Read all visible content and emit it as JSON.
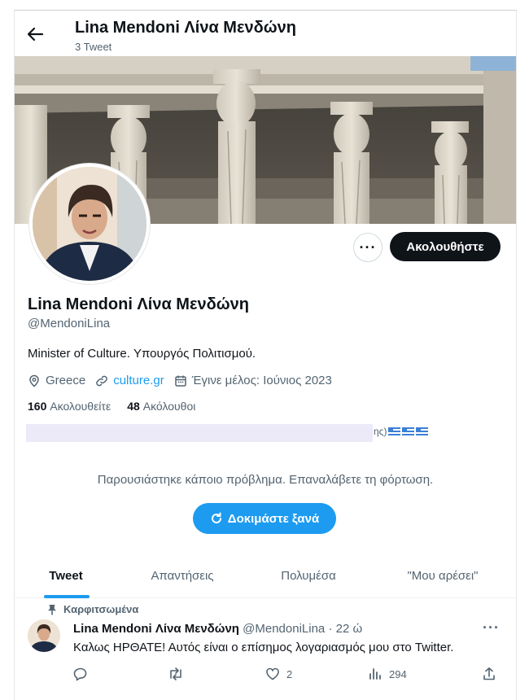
{
  "header": {
    "name": "Lina Mendoni Λίνα Μενδώνη",
    "tweet_count": "3 Tweet"
  },
  "profile": {
    "name": "Lina Mendoni Λίνα Μενδώνη",
    "handle": "@MendoniLina",
    "bio": "Minister of Culture. Υπουργός Πολιτισμού.",
    "location": "Greece",
    "website": "culture.gr",
    "joined": "Έγινε μέλος: Ιούνιος 2023",
    "following_count": "160",
    "following_label": "Ακολουθείτε",
    "followers_count": "48",
    "followers_label": "Ακόλουθοι",
    "follow_button": "Ακολουθήστε",
    "redacted_tail": "ης)"
  },
  "error": {
    "message": "Παρουσιάστηκε κάποιο πρόβλημα. Επαναλάβετε τη φόρτωση.",
    "retry_label": "Δοκιμάστε ξανά"
  },
  "tabs": [
    {
      "label": "Tweet",
      "active": true
    },
    {
      "label": "Απαντήσεις",
      "active": false
    },
    {
      "label": "Πολυμέσα",
      "active": false
    },
    {
      "label": "\"Μου αρέσει\"",
      "active": false
    }
  ],
  "tweet": {
    "pinned_label": "Καρφιτσωμένα",
    "author_name": "Lina Mendoni Λίνα Μενδώνη",
    "author_handle": "@MendoniLina",
    "separator": "·",
    "time": "22 ώ",
    "text": "Καλως ΗΡΘΑΤΕ! Αυτός είναι ο επίσημος λογαριασμός μου στο Twitter.",
    "likes": "2",
    "views": "294"
  },
  "colors": {
    "accent": "#1d9bf0",
    "text_primary": "#0f1419",
    "text_secondary": "#536471",
    "follow_button_bg": "#0f1419"
  }
}
